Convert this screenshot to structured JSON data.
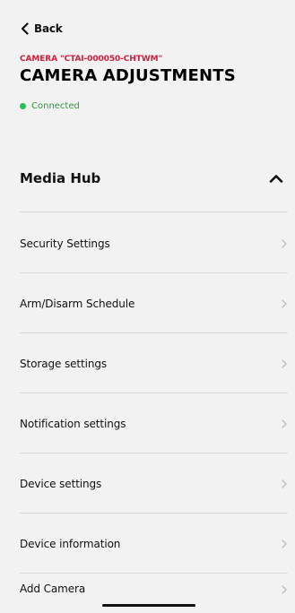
{
  "nav": {
    "back_label": "Back"
  },
  "header": {
    "camera_label": "CAMERA \"CTAI-000050-CHTWM\"",
    "title": "CAMERA ADJUSTMENTS",
    "status": "Connected"
  },
  "section": {
    "title": "Media Hub"
  },
  "menu": {
    "items": [
      {
        "label": "Security Settings"
      },
      {
        "label": "Arm/Disarm Schedule"
      },
      {
        "label": "Storage settings"
      },
      {
        "label": "Notification settings"
      },
      {
        "label": "Device settings"
      },
      {
        "label": "Device information"
      },
      {
        "label": "Add Camera"
      }
    ]
  },
  "colors": {
    "background": "#f2f2f2",
    "accent_red": "#d61b3a",
    "status_green": "#2bbd55",
    "divider": "#d9d9d9"
  },
  "icons": {
    "back": "chevron-left-icon",
    "section_toggle": "chevron-up-icon",
    "menu_item": "chevron-right-icon"
  }
}
